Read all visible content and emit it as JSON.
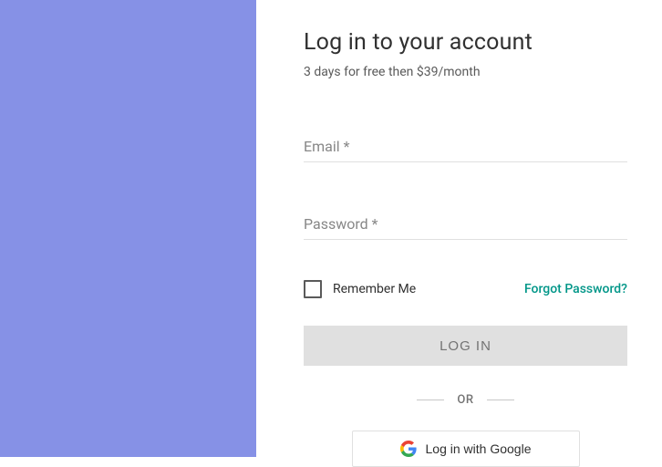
{
  "header": {
    "title": "Log in to your account",
    "subtitle": "3 days for free then $39/month"
  },
  "form": {
    "email_label": "Email *",
    "password_label": "Password *",
    "email_value": "",
    "password_value": ""
  },
  "options": {
    "remember_label": "Remember Me",
    "forgot_label": "Forgot Password?"
  },
  "actions": {
    "login_button": "LOG IN",
    "or_text": "OR",
    "google_button": "Log in with Google"
  },
  "colors": {
    "accent": "#009688",
    "left_panel": "#8691e6"
  }
}
